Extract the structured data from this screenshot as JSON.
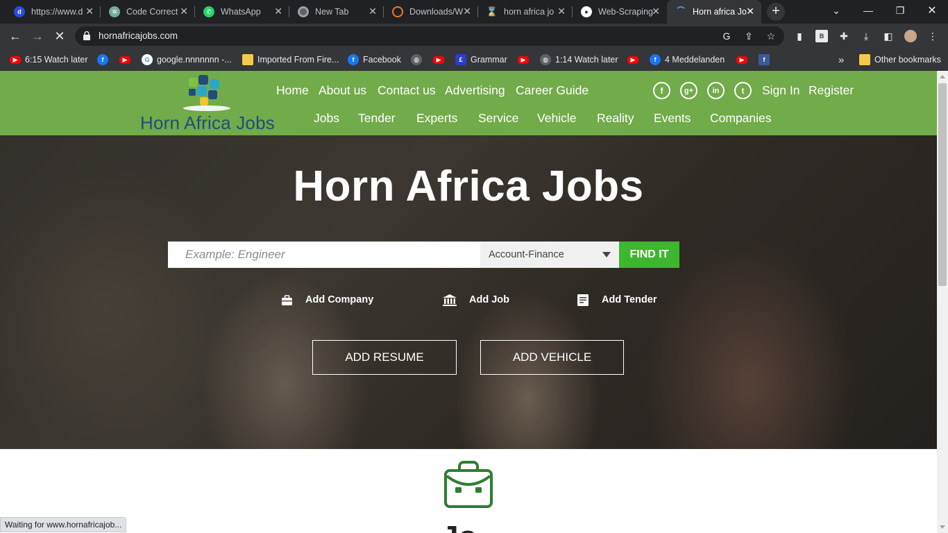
{
  "browser": {
    "tabs": [
      {
        "title": "https://www.d",
        "icon": "d-letter-icon",
        "color": "#2b4bdc"
      },
      {
        "title": "Code Correct",
        "icon": "chatgpt-icon",
        "color": "#74aa9c"
      },
      {
        "title": "WhatsApp",
        "icon": "whatsapp-icon",
        "color": "#25d366"
      },
      {
        "title": "New Tab",
        "icon": "chrome-icon",
        "color": "#5f6368"
      },
      {
        "title": "Downloads/W",
        "icon": "jupyter-icon",
        "color": "#f37726"
      },
      {
        "title": "horn africa jo",
        "icon": "hourglass-icon",
        "color": "#f39c12"
      },
      {
        "title": "Web-Scraping",
        "icon": "github-icon",
        "color": "#24292e"
      },
      {
        "title": "Horn africa Jo",
        "icon": "loading-icon",
        "color": "#4a90e2"
      }
    ],
    "url": "hornafricajobs.com",
    "bookmarks": [
      {
        "label": "6:15 Watch later",
        "icon": "youtube-icon"
      },
      {
        "label": "",
        "icon": "facebook-icon"
      },
      {
        "label": "",
        "icon": "youtube-icon"
      },
      {
        "label": "google.nnnnnnn -...",
        "icon": "google-icon"
      },
      {
        "label": "Imported From Fire...",
        "icon": "folder-icon"
      },
      {
        "label": "Facebook",
        "icon": "facebook-icon"
      },
      {
        "label": "",
        "icon": "globe-icon"
      },
      {
        "label": "",
        "icon": "youtube-icon"
      },
      {
        "label": "Grammar",
        "icon": "grammar-icon"
      },
      {
        "label": "",
        "icon": "youtube-icon"
      },
      {
        "label": "1:14 Watch later",
        "icon": "globe-icon"
      },
      {
        "label": "",
        "icon": "youtube-icon"
      },
      {
        "label": "4 Meddelanden",
        "icon": "facebook-icon"
      },
      {
        "label": "",
        "icon": "youtube-icon"
      },
      {
        "label": "",
        "icon": "facebook-square-icon"
      }
    ],
    "other_bookmarks": "Other bookmarks",
    "overflow": "»",
    "status": "Waiting for www.hornafricajob..."
  },
  "site": {
    "brand": "Horn Africa Jobs",
    "nav_top": [
      "Home",
      "About us",
      "Contact us",
      "Advertising",
      "Career Guide"
    ],
    "nav_bottom": [
      "Jobs",
      "Tender",
      "Experts",
      "Service",
      "Vehicle",
      "Reality",
      "Events",
      "Companies"
    ],
    "auth": {
      "signin": "Sign In",
      "register": "Register"
    },
    "social": [
      {
        "name": "facebook-icon",
        "glyph": "f"
      },
      {
        "name": "google-plus-icon",
        "glyph": "g+"
      },
      {
        "name": "linkedin-icon",
        "glyph": "in"
      },
      {
        "name": "twitter-icon",
        "glyph": "t"
      }
    ],
    "colors": {
      "header": "#72ab4a",
      "find_button": "#3cb72f",
      "brand_text": "#1f4e79",
      "bag_icon": "#2e7d32"
    }
  },
  "hero": {
    "title": "Horn Africa Jobs",
    "search_placeholder": "Example: Engineer",
    "category_selected": "Account-Finance",
    "find_button": "FIND IT",
    "add_links": {
      "company": "Add Company",
      "job": "Add Job",
      "tender": "Add Tender"
    },
    "buttons": {
      "resume": "ADD RESUME",
      "vehicle": "ADD VEHICLE"
    }
  },
  "below": {
    "partial_heading": "Jo"
  }
}
